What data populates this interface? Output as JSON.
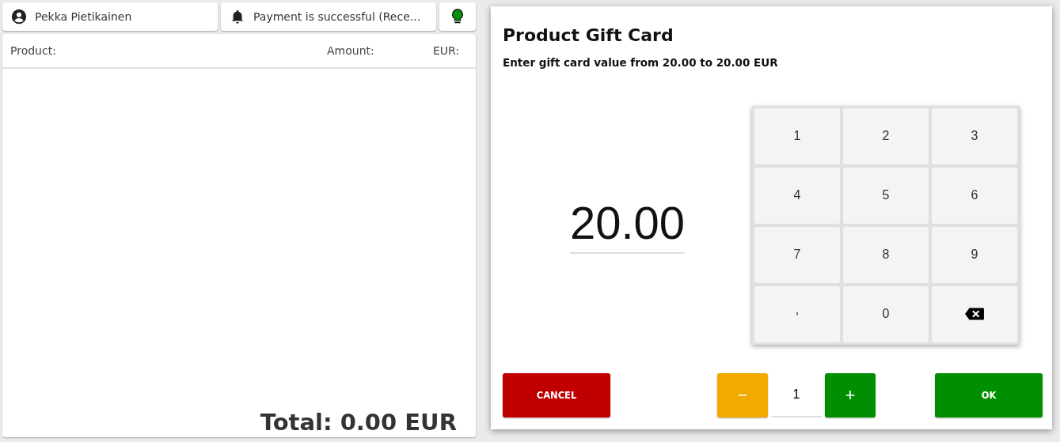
{
  "header": {
    "user": "Pekka Pietikainen",
    "notification": "Payment is successful (Rece..."
  },
  "cart": {
    "columns": [
      "Product:",
      "Amount:",
      "EUR:"
    ],
    "total": "Total: 0.00 EUR"
  },
  "dialog": {
    "title": "Product Gift Card",
    "subtitle": "Enter gift card value from 20.00 to 20.00 EUR",
    "value": "20.00",
    "keys": [
      {
        "kind": "digit",
        "label": "1"
      },
      {
        "kind": "digit",
        "label": "2"
      },
      {
        "kind": "digit",
        "label": "3"
      },
      {
        "kind": "digit",
        "label": "4"
      },
      {
        "kind": "digit",
        "label": "5"
      },
      {
        "kind": "digit",
        "label": "6"
      },
      {
        "kind": "digit",
        "label": "7"
      },
      {
        "kind": "digit",
        "label": "8"
      },
      {
        "kind": "digit",
        "label": "9"
      },
      {
        "kind": "separator",
        "label": ","
      },
      {
        "kind": "digit",
        "label": "0"
      },
      {
        "kind": "backspace"
      }
    ],
    "cancel": "CANCEL",
    "minus": "−",
    "quantity": "1",
    "plus": "+",
    "ok": "OK"
  }
}
